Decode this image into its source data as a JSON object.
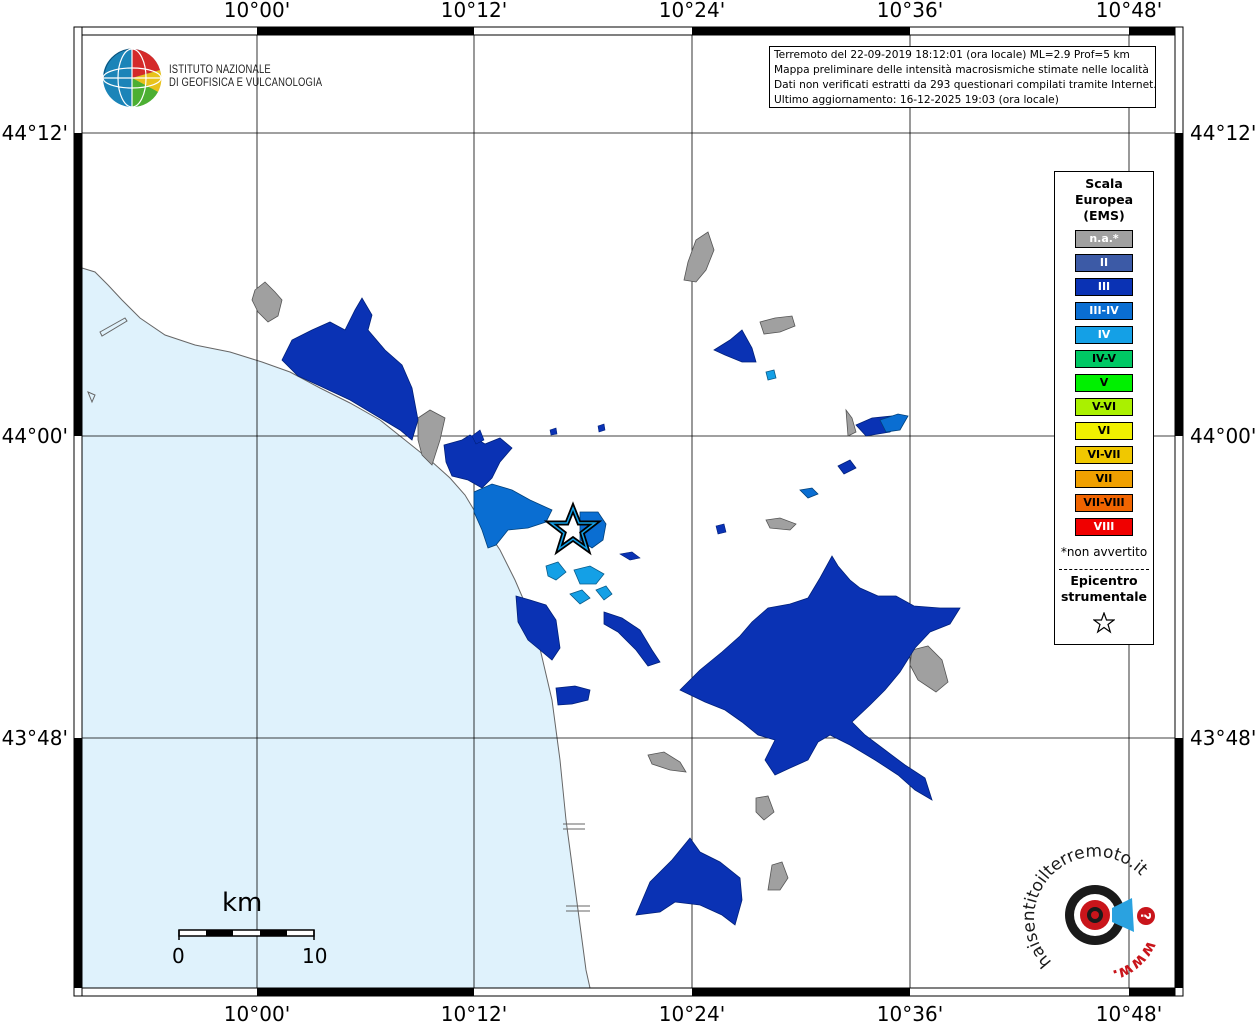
{
  "map": {
    "lon_ticks": [
      "10°00'",
      "10°12'",
      "10°24'",
      "10°36'",
      "10°48'"
    ],
    "lat_ticks": [
      "44°12'",
      "44°00'",
      "43°48'"
    ]
  },
  "header": {
    "institute_line1": "ISTITUTO NAZIONALE",
    "institute_line2": "DI GEOFISICA E VULCANOLOGIA",
    "info_lines": [
      "Terremoto del 22-09-2019 18:12:01 (ora locale) ML=2.9 Prof=5 km",
      "Mappa preliminare delle intensità macrosismiche stimate nelle località",
      "Dati non verificati estratti da 293 questionari compilati tramite Internet.",
      "Ultimo aggiornamento: 16-12-2025 19:03 (ora locale)"
    ]
  },
  "legend": {
    "title_lines": [
      "Scala",
      "Europea",
      "(EMS)"
    ],
    "items": [
      {
        "label": "n.a.*",
        "color": "#a0a0a0",
        "text_color": "#ffffff"
      },
      {
        "label": "II",
        "color": "#3c5aa6",
        "text_color": "#ffffff"
      },
      {
        "label": "III",
        "color": "#0a32b4",
        "text_color": "#ffffff"
      },
      {
        "label": "III-IV",
        "color": "#0a6ed2",
        "text_color": "#ffffff"
      },
      {
        "label": "IV",
        "color": "#14a0e6",
        "text_color": "#ffffff"
      },
      {
        "label": "IV-V",
        "color": "#00c864",
        "text_color": "#000000"
      },
      {
        "label": "V",
        "color": "#00f000",
        "text_color": "#000000"
      },
      {
        "label": "V-VI",
        "color": "#aaf000",
        "text_color": "#000000"
      },
      {
        "label": "VI",
        "color": "#f0f000",
        "text_color": "#000000"
      },
      {
        "label": "VI-VII",
        "color": "#f0c800",
        "text_color": "#000000"
      },
      {
        "label": "VII",
        "color": "#f0a000",
        "text_color": "#000000"
      },
      {
        "label": "VII-VIII",
        "color": "#f06400",
        "text_color": "#000000"
      },
      {
        "label": "VIII",
        "color": "#f00000",
        "text_color": "#ffffff"
      }
    ],
    "note": "*non avvertito",
    "epicenter_line1": "Epicentro",
    "epicenter_line2": "strumentale"
  },
  "scale_bar": {
    "unit": "km",
    "min_label": "0",
    "max_label": "10"
  },
  "branding": {
    "hsi_text": "haisentitoilterremoto.it",
    "hsi_www": "www.",
    "question_mark": "?"
  },
  "colors": {
    "sea": "#dff2fc",
    "gray_na": "#a0a0a0",
    "ems_iii": "#0a32b4",
    "ems_iii_iv": "#0a6ed2",
    "ems_iv": "#14a0e6"
  }
}
